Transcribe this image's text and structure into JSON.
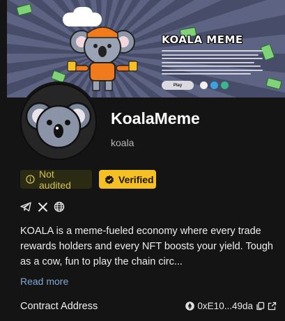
{
  "banner": {
    "title": "KOALA MEME",
    "play_label": "Play"
  },
  "profile": {
    "name": "KoalaMeme",
    "ticker": "koala"
  },
  "badges": {
    "audit": "Not audited",
    "verified": "Verified"
  },
  "socials": [
    "telegram-icon",
    "x-icon",
    "globe-icon"
  ],
  "description": "KOALA is a meme-fueled economy where every trade rewards holders and every NFT boosts your yield. Tough as a cow, fun to play the chain circ...",
  "read_more": "Read more",
  "contract": {
    "label": "Contract Address",
    "address": "0xE10...49da"
  },
  "colors": {
    "background": "#141414",
    "verified": "#f5c023",
    "unaudited_bg": "#2b2a12",
    "unaudited_text": "#d2c252",
    "link": "#7fa9d6"
  }
}
